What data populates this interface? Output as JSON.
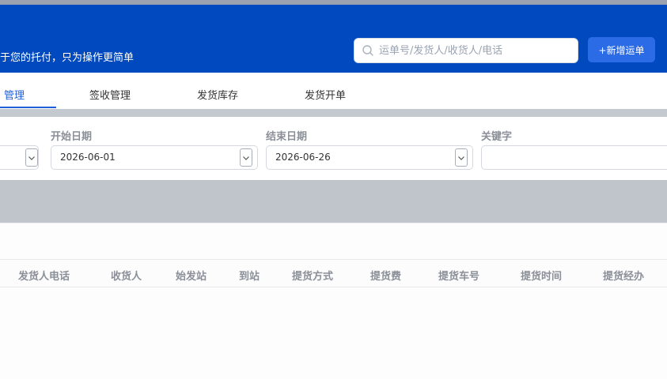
{
  "header": {
    "slogan": "于您的托付，只为操作更简单",
    "search_placeholder": "运单号/发货人/收货人/电话",
    "add_button": "+新增运单",
    "color": "#0049bf"
  },
  "tabs": [
    {
      "label": "管理",
      "active": true
    },
    {
      "label": "签收管理",
      "active": false
    },
    {
      "label": "发货库存",
      "active": false
    },
    {
      "label": "发货开单",
      "active": false
    }
  ],
  "filters": {
    "start_date": {
      "label": "开始日期",
      "value": "2026-06-01"
    },
    "end_date": {
      "label": "结束日期",
      "value": "2026-06-26"
    },
    "keyword": {
      "label": "关键字",
      "value": ""
    }
  },
  "table": {
    "columns": [
      "发货人电话",
      "收货人",
      "始发站",
      "到站",
      "提货方式",
      "提货费",
      "提货车号",
      "提货时间",
      "提货经办"
    ]
  }
}
